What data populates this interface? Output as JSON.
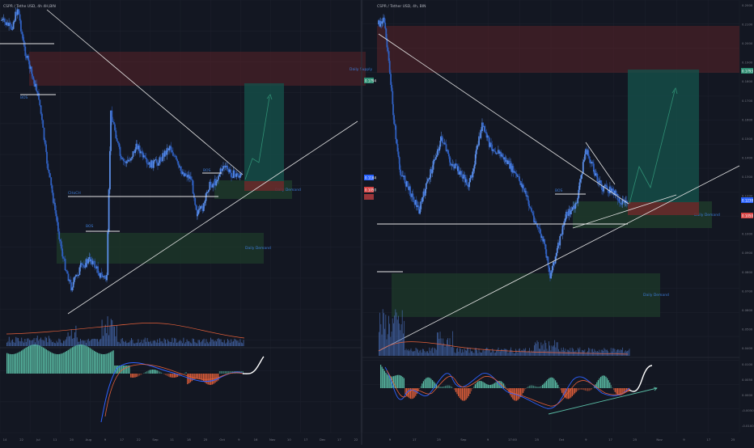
{
  "colors": {
    "background": "#131722",
    "grid": "#1e2230",
    "divider": "#2a2e39",
    "axis_text": "#787b86",
    "candle": "#4a7bd8",
    "candle_dark": "#2a4f9c",
    "line_white": "#e6e6e6",
    "supply_zone": "#5a2328",
    "demand_zone": "#1e3a2a",
    "target_box": "#15504a",
    "stop_box": "#6b2a2a",
    "macd_teal": "#5bc0a8",
    "macd_red": "#e5603a",
    "macd_blue": "#2e62ff",
    "price_label_blue": "#2962ff",
    "price_label_red": "#d64545",
    "price_label_green": "#2f8f74"
  },
  "left_chart": {
    "title": "CSPR / Tethe USD, 4h 4H,BIN",
    "labels": {
      "bos_1": "BOS",
      "bos_2": "BOS",
      "bos_3": "BOS",
      "choch": "CHoCH",
      "daily_supply": "Daily Supply",
      "daily_demand_small": "Daily Demand",
      "daily_demand_large": "Daily Demand"
    },
    "x_axis": [
      "14",
      "22",
      "Jul",
      "11",
      "20",
      "Aug",
      "9",
      "17",
      "22",
      "Sep",
      "11",
      "18",
      "25",
      "Oct",
      "9",
      "16",
      "Nov",
      "10",
      "17",
      "Dec",
      "17",
      "22"
    ]
  },
  "right_chart": {
    "title": "CSPR / Tether USD, 4h, BIN",
    "labels": {
      "bos": "BOS",
      "daily_supply": "Daily Supply",
      "daily_demand_small": "Daily Demand",
      "daily_demand_large": "Daily Demand"
    },
    "price_axis": [
      "0.2000",
      "0.2100",
      "0.2000",
      "0.1900",
      "0.1800",
      "0.1700",
      "0.1600",
      "0.1500",
      "0.1400",
      "0.1300",
      "0.1200",
      "0.1100",
      "0.1000",
      "0.0900",
      "0.0800",
      "0.0700",
      "0.0600",
      "0.0500",
      "0.0400"
    ],
    "price_tags": {
      "upper": "0.1793",
      "current": "0.1238",
      "red": "0.1050"
    },
    "macd_axis": [
      "0.0100",
      "0.0050",
      "0.0000",
      "-0.0050",
      "-0.0100"
    ],
    "x_axis": [
      "9",
      "17",
      "25",
      "Sep",
      "9",
      "17:00",
      "25",
      "Oct",
      "9",
      "17",
      "25",
      "Nov",
      "9",
      "17",
      "25"
    ]
  },
  "left_price_tags": {
    "upper": "0.1794",
    "mid_blue": "0.1184",
    "mid_red": "0.1050"
  }
}
